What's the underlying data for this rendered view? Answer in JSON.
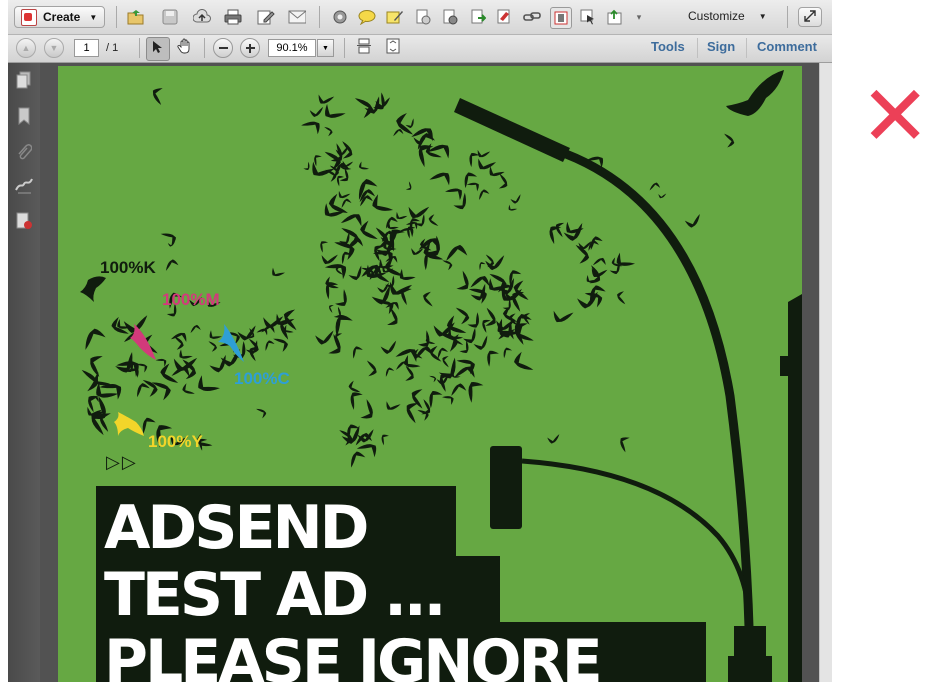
{
  "toolbar": {
    "create_label": "Create",
    "customize_label": "Customize",
    "icons": [
      "create-pdf-icon",
      "open-folder-icon",
      "save-icon",
      "cloud-upload-icon",
      "print-icon",
      "edit-icon",
      "email-icon",
      "settings-icon",
      "comment-icon",
      "highlight-icon",
      "pages-icon",
      "page-extract-icon",
      "page-export-icon",
      "sign-icon",
      "link-icon",
      "fit-page-icon",
      "select-icon",
      "attach-icon",
      "menu-arrow-icon"
    ]
  },
  "nav": {
    "page_current": "1",
    "page_total": "/ 1",
    "zoom": "90.1%",
    "tools_label": "Tools",
    "sign_label": "Sign",
    "comment_label": "Comment"
  },
  "sidebar": {
    "icons": [
      "page-thumbnails-icon",
      "bookmarks-icon",
      "attachments-icon",
      "signatures-icon",
      "content-icon"
    ]
  },
  "document": {
    "color_labels": {
      "black": "100%K",
      "magenta": "100%M",
      "cyan": "100%C",
      "yellow": "100%Y"
    },
    "headline": [
      "ADSEND",
      "TEST AD ...",
      "PLEASE IGNORE"
    ],
    "play_symbols": "▷▷"
  },
  "overlay": {
    "mark": "✕"
  },
  "colors": {
    "page_green": "#66a843",
    "ink_dark": "#101c0e",
    "magenta": "#d23a7b",
    "cyan": "#2e9fd6",
    "yellow": "#f2d52a",
    "close_red": "#ec4057",
    "link_blue": "#3d6c9c"
  }
}
